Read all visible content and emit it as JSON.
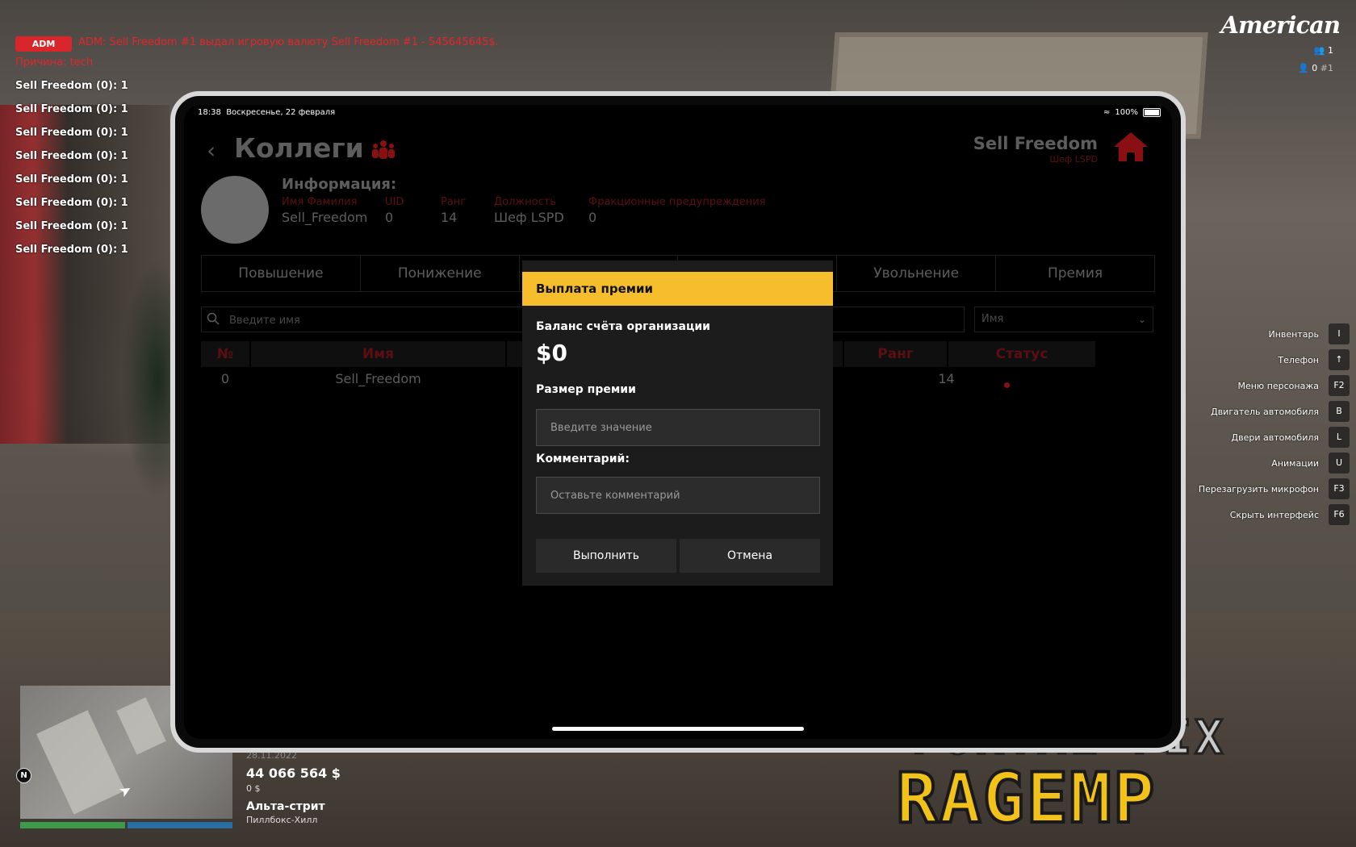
{
  "chat": {
    "adm_tag": "ADM",
    "adm_message": "ADM: Sell Freedom #1 выдал игровую валюту Sell Freedom #1 - 545645645$.",
    "reason": "Причина: tech",
    "lines": [
      "Sell Freedom (0): 1",
      "Sell Freedom (0): 1",
      "Sell Freedom (0): 1",
      "Sell Freedom (0): 1",
      "Sell Freedom (0): 1",
      "Sell Freedom (0): 1",
      "Sell Freedom (0): 1",
      "Sell Freedom (0): 1"
    ]
  },
  "hud": {
    "server_name": "American",
    "online_count": "1",
    "player_id": "0",
    "player_id_hash": "#1",
    "hotkeys": [
      {
        "label": "Инвентарь",
        "key": "I"
      },
      {
        "label": "Телефон",
        "key": "↑"
      },
      {
        "label": "Меню персонажа",
        "key": "F2"
      },
      {
        "label": "Двигатель автомобиля",
        "key": "B"
      },
      {
        "label": "Двери автомобиля",
        "key": "L"
      },
      {
        "label": "Анимации",
        "key": "U"
      },
      {
        "label": "Перезагрузить микрофон",
        "key": "F3"
      },
      {
        "label": "Скрыть интерфейс",
        "key": "F6"
      }
    ],
    "compass": "N",
    "date": "28.11.2022",
    "cash": "44 066 564 $",
    "bank": "0 $",
    "street": "Альта-стрит",
    "district": "Пиллбокс-Хилл"
  },
  "watermark": {
    "line1": "PORTAL FIX",
    "line2": "RAGEMP"
  },
  "tablet": {
    "status_time": "18:38",
    "status_date": "Воскресенье, 22 февраля",
    "battery": "100%",
    "page_title": "Коллеги",
    "user_name": "Sell Freedom",
    "user_role": "Шеф LSPD",
    "info": {
      "title": "Информация:",
      "name_label": "Имя Фамилия",
      "name_value": "Sell_Freedom",
      "uid_label": "UID",
      "uid_value": "0",
      "rank_label": "Ранг",
      "rank_value": "14",
      "position_label": "Должность",
      "position_value": "Шеф LSPD",
      "warnings_label": "Фракционные предупреждения",
      "warnings_value": "0"
    },
    "tabs": [
      "Повышение",
      "Понижение",
      "",
      "",
      "Увольнение",
      "Премия"
    ],
    "search_placeholder": "Введите имя",
    "sort_value": "Имя",
    "table": {
      "headers": [
        "№",
        "Имя",
        "",
        "",
        "Ранг",
        "Статус"
      ],
      "rows": [
        {
          "num": "0",
          "name": "Sell_Freedom",
          "rank": "14"
        }
      ]
    },
    "accent_color": "#8a0f12"
  },
  "modal": {
    "title": "Выплата премии",
    "balance_label": "Баланс счёта организации",
    "balance_value": "$0",
    "amount_label": "Размер премии",
    "amount_placeholder": "Введите значение",
    "comment_label": "Комментарий:",
    "comment_placeholder": "Оставьте комментарий",
    "confirm_label": "Выполнить",
    "cancel_label": "Отмена",
    "header_color": "#f6bd2c"
  }
}
